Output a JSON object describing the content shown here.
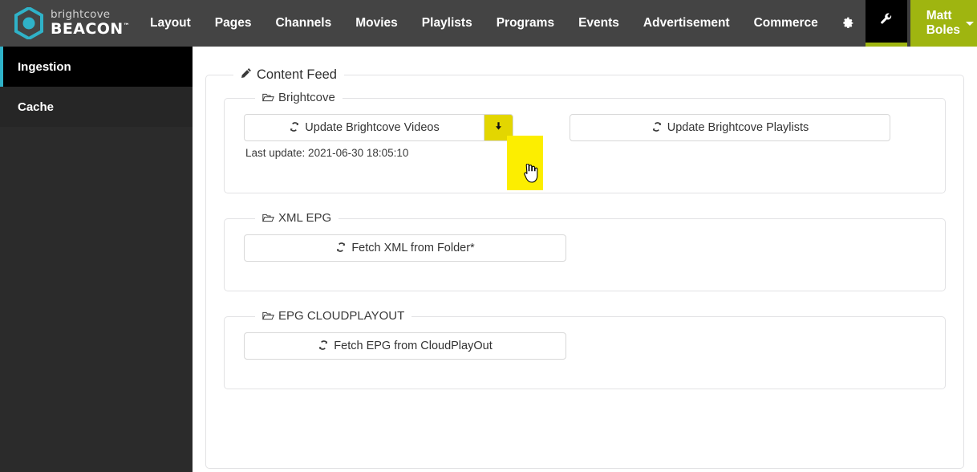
{
  "brand": {
    "logo_icon": "brightcove-hexagon-logo-icon",
    "name_top": "brightcove",
    "name_bottom": "BEACON",
    "trademark": "™"
  },
  "topnav": {
    "items": [
      {
        "label": "Layout",
        "name": "nav-item-layout"
      },
      {
        "label": "Pages",
        "name": "nav-item-pages"
      },
      {
        "label": "Channels",
        "name": "nav-item-channels"
      },
      {
        "label": "Movies",
        "name": "nav-item-movies"
      },
      {
        "label": "Playlists",
        "name": "nav-item-playlists"
      },
      {
        "label": "Programs",
        "name": "nav-item-programs"
      },
      {
        "label": "Events",
        "name": "nav-item-events"
      },
      {
        "label": "Advertisement",
        "name": "nav-item-advertisement"
      },
      {
        "label": "Commerce",
        "name": "nav-item-commerce"
      }
    ],
    "settings_icon": "gear-icon",
    "tools_icon": "wrench-icon",
    "user_label": "Matt Boles",
    "user_caret_icon": "caret-down-icon",
    "accent_color": "#9fb510",
    "bar_color": "#444444"
  },
  "sidebar": {
    "items": [
      {
        "label": "Ingestion",
        "name": "sidebar-item-ingestion",
        "active": true
      },
      {
        "label": "Cache",
        "name": "sidebar-item-cache",
        "active": false
      }
    ],
    "active_indicator_color": "#2fb2c8"
  },
  "main": {
    "panel_legend": "Content Feed",
    "panel_legend_icon": "pencil-icon",
    "groups": [
      {
        "legend": "Brightcove",
        "legend_icon": "open-folder-icon",
        "update_videos_label": "Update Brightcove Videos",
        "update_videos_icon": "sync-refresh-icon",
        "download_videos_icon": "download-arrow-icon",
        "update_playlists_label": "Update Brightcove Playlists",
        "update_playlists_icon": "sync-refresh-icon",
        "last_update": "Last update: 2021-06-30 18:05:10"
      },
      {
        "legend": "XML EPG",
        "legend_icon": "open-folder-icon",
        "fetch_label": "Fetch XML from Folder*",
        "fetch_icon": "sync-refresh-icon"
      },
      {
        "legend": "EPG CLOUDPLAYOUT",
        "legend_icon": "open-folder-icon",
        "fetch_label": "Fetch EPG from CloudPlayOut",
        "fetch_icon": "sync-refresh-icon"
      }
    ]
  },
  "highlight": {
    "name": "download-button-highlight",
    "color": "#fcee00",
    "cursor_icon": "pointing-hand-cursor-icon"
  }
}
